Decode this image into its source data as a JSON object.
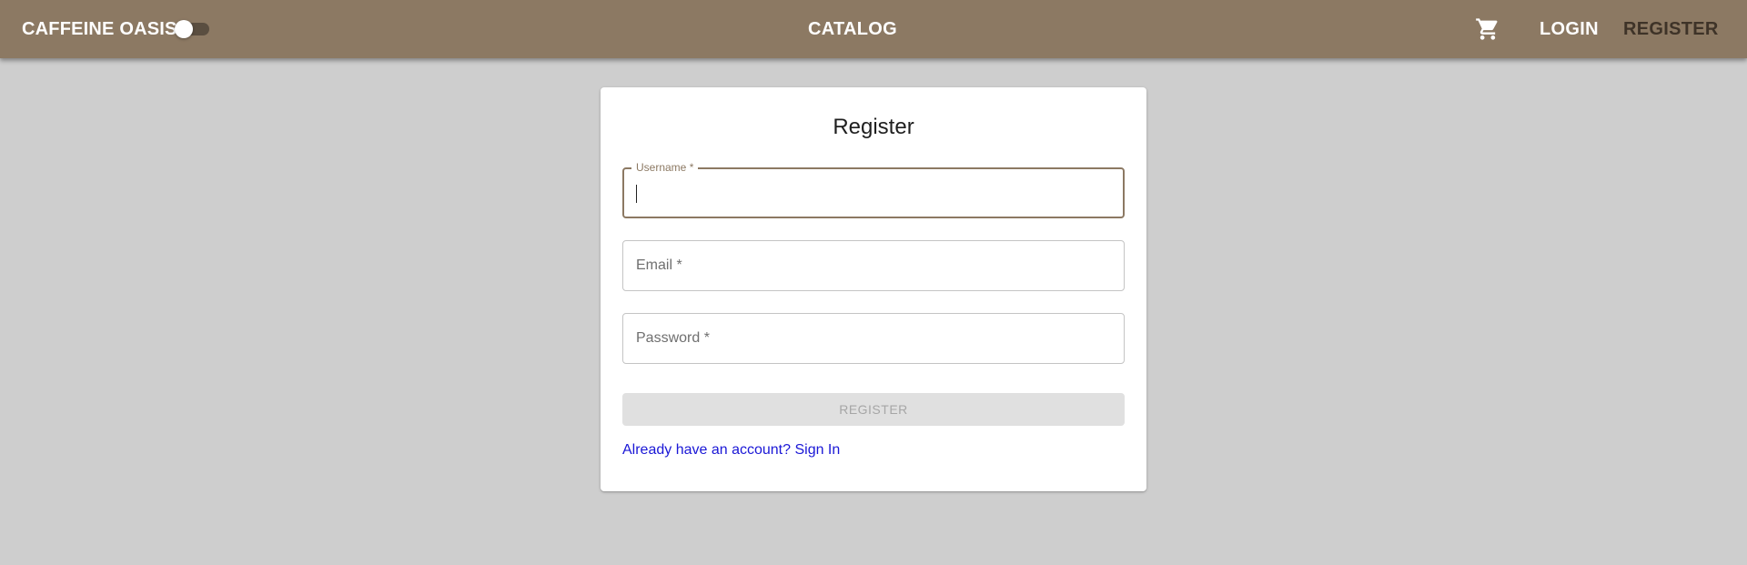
{
  "appbar": {
    "brand": "CAFFEINE OASIS",
    "theme_toggle": {
      "state": "off"
    },
    "catalog": "CATALOG",
    "cart_icon": "shopping-cart-icon",
    "login": "LOGIN",
    "register": "REGISTER"
  },
  "form": {
    "title": "Register",
    "username": {
      "label": "Username *",
      "value": ""
    },
    "email": {
      "placeholder": "Email *"
    },
    "password": {
      "placeholder": "Password *"
    },
    "submit_label": "REGISTER",
    "signin_link": "Already have an account? Sign In"
  },
  "colors": {
    "appbar": "#8c7963",
    "background": "#cecece",
    "link": "#1a17d6",
    "disabled_button": "#e0e0e0"
  }
}
